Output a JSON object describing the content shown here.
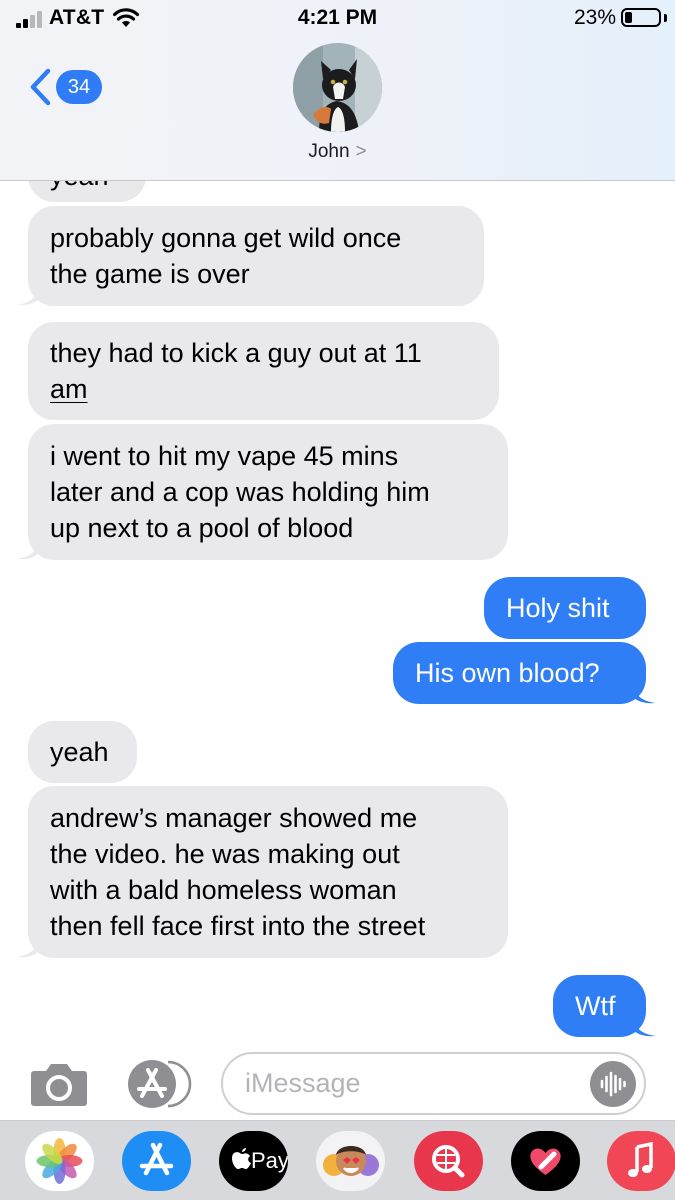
{
  "status_bar": {
    "carrier": "AT&T",
    "time": "4:21 PM",
    "battery_percent": "23%"
  },
  "header": {
    "back_badge": "34",
    "contact_name": "John",
    "contact_chevron": ">"
  },
  "messages": [
    {
      "from": "contact",
      "lines": [
        "yeah"
      ]
    },
    {
      "from": "contact",
      "lines": [
        "probably gonna get wild once",
        "the game is over"
      ]
    },
    {
      "from": "contact",
      "lines": [
        "they had to kick a guy out at 11",
        "am"
      ]
    },
    {
      "from": "contact",
      "lines": [
        "i went to hit my vape 45 mins",
        "later and a cop was holding him",
        "up next to a pool of blood"
      ]
    },
    {
      "from": "me",
      "lines": [
        "Holy shit"
      ]
    },
    {
      "from": "me",
      "lines": [
        "His own blood?"
      ]
    },
    {
      "from": "contact",
      "lines": [
        "yeah"
      ]
    },
    {
      "from": "contact",
      "lines": [
        "andrew’s manager showed me",
        "the video. he was making out",
        "with a bald homeless woman",
        "then fell face first into the street"
      ]
    },
    {
      "from": "me",
      "lines": [
        "Wtf"
      ]
    }
  ],
  "input": {
    "placeholder": "iMessage"
  },
  "app_drawer": {
    "apps": [
      {
        "icon": "photos-icon"
      },
      {
        "icon": "app-store-icon"
      },
      {
        "icon": "apple-pay-icon",
        "label": "Pay"
      },
      {
        "icon": "memoji-stickers-icon"
      },
      {
        "icon": "image-search-icon"
      },
      {
        "icon": "digital-touch-icon"
      },
      {
        "icon": "music-icon"
      }
    ]
  },
  "colors": {
    "incoming_bubble": "#e9e9eb",
    "outgoing_bubble": "#2f7ef6",
    "accent": "#2f7cf6"
  }
}
